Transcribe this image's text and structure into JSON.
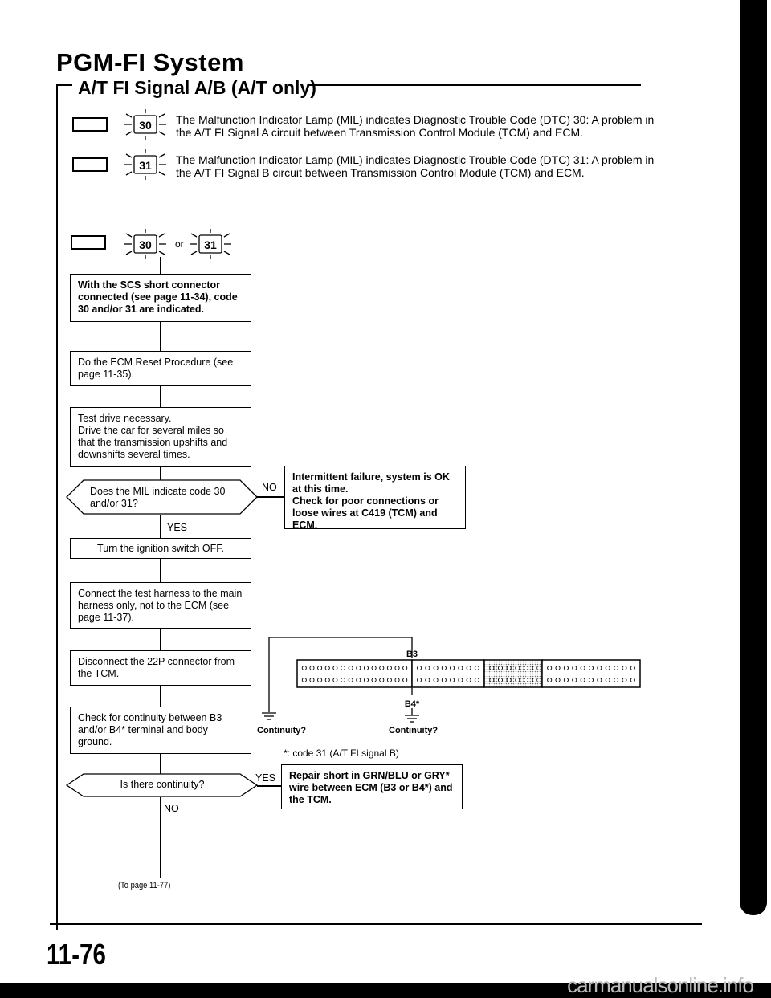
{
  "header": {
    "title": "PGM-FI System",
    "subtitle": "A/T FI Signal A/B (A/T only)"
  },
  "codes": [
    {
      "code": "30",
      "line1": "The Malfunction Indicator Lamp (MIL) indicates Diagnostic Trouble Code (DTC) 30: A problem in",
      "line2": "the A/T FI Signal A circuit between Transmission Control Module (TCM) and ECM."
    },
    {
      "code": "31",
      "line1": "The Malfunction Indicator Lamp (MIL) indicates Diagnostic Trouble Code (DTC) 31: A problem in",
      "line2": "the A/T FI Signal B circuit between Transmission Control Module (TCM) and ECM."
    }
  ],
  "combined": {
    "code_a": "30",
    "or_label": "or",
    "code_b": "31"
  },
  "flow": {
    "step1": "With the SCS short connector connected (see page 11-34), code 30 and/or 31 are indicated.",
    "step2": "Do the ECM Reset Procedure (see page 11-35).",
    "step3_line1": "Test drive necessary.",
    "step3_line2": "Drive the car for several miles so that the transmission upshifts and downshifts several times.",
    "decision1": "Does the MIL indicate code 30 and/or 31?",
    "decision1_no": "NO",
    "decision1_yes": "YES",
    "no_result_line1": "Intermittent failure, system is OK at this time.",
    "no_result_line2": "Check for poor connections or loose wires at C419 (TCM) and ECM.",
    "step4": "Turn the ignition switch OFF.",
    "step5": "Connect the test harness to the main harness only, not to the ECM (see page 11-37).",
    "step6": "Disconnect the 22P connector from the TCM.",
    "step7": "Check for continuity between B3 and/or B4* terminal and body ground.",
    "decision2": "Is there continuity?",
    "decision2_yes": "YES",
    "decision2_no": "NO",
    "yes_result": "Repair short in GRN/BLU or GRY* wire between ECM (B3 or B4*) and the TCM.",
    "continue": "(To page 11-77)"
  },
  "connector": {
    "b3_label": "B3",
    "b4_label": "B4*",
    "continuity_left": "Continuity?",
    "continuity_right": "Continuity?",
    "footnote": "*: code 31 (A/T FI signal B)",
    "sections": [
      {
        "pins_per_row": 14,
        "shaded": false
      },
      {
        "pins_per_row": 8,
        "shaded": false
      },
      {
        "pins_per_row": 6,
        "shaded": true
      },
      {
        "pins_per_row": 11,
        "shaded": false
      }
    ]
  },
  "footer": {
    "page_number": "11-76",
    "watermark": "carmanualsonline.info"
  }
}
